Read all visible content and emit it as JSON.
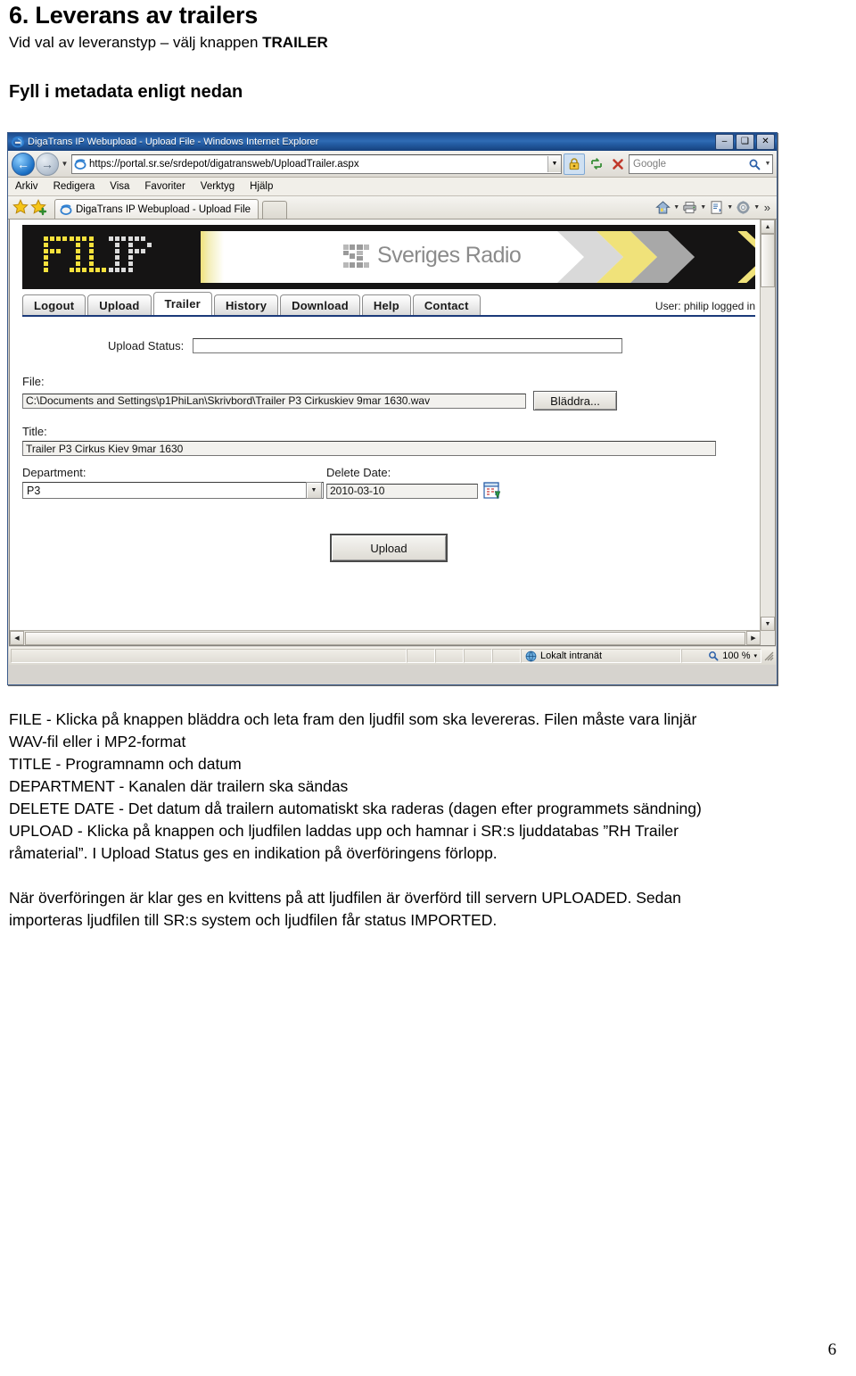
{
  "document": {
    "heading": "6. Leverans av trailers",
    "subheading_prefix": "Vid val av leveranstyp – välj knappen ",
    "subheading_bold": "TRAILER",
    "section_heading": "Fyll i metadata enligt nedan",
    "page_number": "6",
    "paragraphs": [
      "FILE - Klicka på knappen bläddra och leta fram den ljudfil som ska levereras. Filen måste vara linjär",
      "WAV-fil eller i MP2-format",
      "TITLE - Programnamn och datum",
      "DEPARTMENT - Kanalen där trailern ska sändas",
      "DELETE DATE - Det datum då trailern automatiskt ska raderas (dagen efter programmets sändning)",
      "UPLOAD - Klicka på knappen och ljudfilen laddas upp och hamnar i SR:s ljuddatabas ”RH Trailer",
      "råmaterial”. I Upload Status ges en indikation på överföringens förlopp."
    ],
    "paragraphs2": [
      "När överföringen är klar ges en kvittens på att ljudfilen är överförd till servern UPLOADED. Sedan",
      "importeras ljudfilen till SR:s  system och ljudfilen får status IMPORTED."
    ]
  },
  "browser": {
    "title": "DigaTrans IP Webupload - Upload File - Windows Internet Explorer",
    "window_controls": {
      "minimize": "–",
      "maximize": "❑",
      "close": "✕"
    },
    "address": {
      "url": "https://portal.sr.se/srdepot/digatransweb/UploadTrailer.aspx",
      "dropdown_icon": "chevron-down-icon"
    },
    "search": {
      "placeholder": "Google",
      "value": ""
    },
    "toolbar_icons": [
      "lock-icon",
      "refresh-icon",
      "stop-icon",
      "search-go-icon"
    ],
    "menu": [
      {
        "label": "Arkiv",
        "accel": "A"
      },
      {
        "label": "Redigera",
        "accel": "R"
      },
      {
        "label": "Visa",
        "accel": "s"
      },
      {
        "label": "Favoriter",
        "accel": "F"
      },
      {
        "label": "Verktyg",
        "accel": "V"
      },
      {
        "label": "Hjälp",
        "accel": "H"
      }
    ],
    "tab_label": "DigaTrans IP Webupload - Upload File",
    "command_icons": [
      "home-icon",
      "print-icon",
      "page-icon",
      "tools-icon"
    ],
    "overflow_chevron": "»",
    "statusbar": {
      "zone": "Lokalt intranät",
      "zoom": "100 %",
      "zoom_caret": "▾"
    }
  },
  "app": {
    "logo_text": "FILIP",
    "brand_text": "Sveriges Radio",
    "brand_mark": "SR",
    "nav_tabs": [
      {
        "label": "Logout",
        "active": false
      },
      {
        "label": "Upload",
        "active": false
      },
      {
        "label": "Trailer",
        "active": true
      },
      {
        "label": "History",
        "active": false
      },
      {
        "label": "Download",
        "active": false
      },
      {
        "label": "Help",
        "active": false
      },
      {
        "label": "Contact",
        "active": false
      }
    ],
    "user_note": "User: philip logged in",
    "form": {
      "upload_status_label": "Upload Status:",
      "upload_status_value": "",
      "file_label": "File:",
      "file_value": "C:\\Documents and Settings\\p1PhiLan\\Skrivbord\\Trailer P3 Cirkuskiev 9mar 1630.wav",
      "browse_label": "Bläddra...",
      "title_label": "Title:",
      "title_value": "Trailer P3 Cirkus Kiev 9mar 1630",
      "department_label": "Department:",
      "department_value": "P3",
      "department_options": [
        "P3"
      ],
      "delete_date_label": "Delete Date:",
      "delete_date_value": "2010-03-10",
      "calendar_icon": "calendar-picker-icon",
      "upload_button_label": "Upload"
    }
  },
  "colors": {
    "banner_black": "#151414",
    "logo_yellow": "#f5e13c",
    "logo_white": "#dcdcdc",
    "brand_grey": "#8b8b8b",
    "tab_underline": "#1b3a7a",
    "titlebar_blue": "#1b4a8c"
  }
}
